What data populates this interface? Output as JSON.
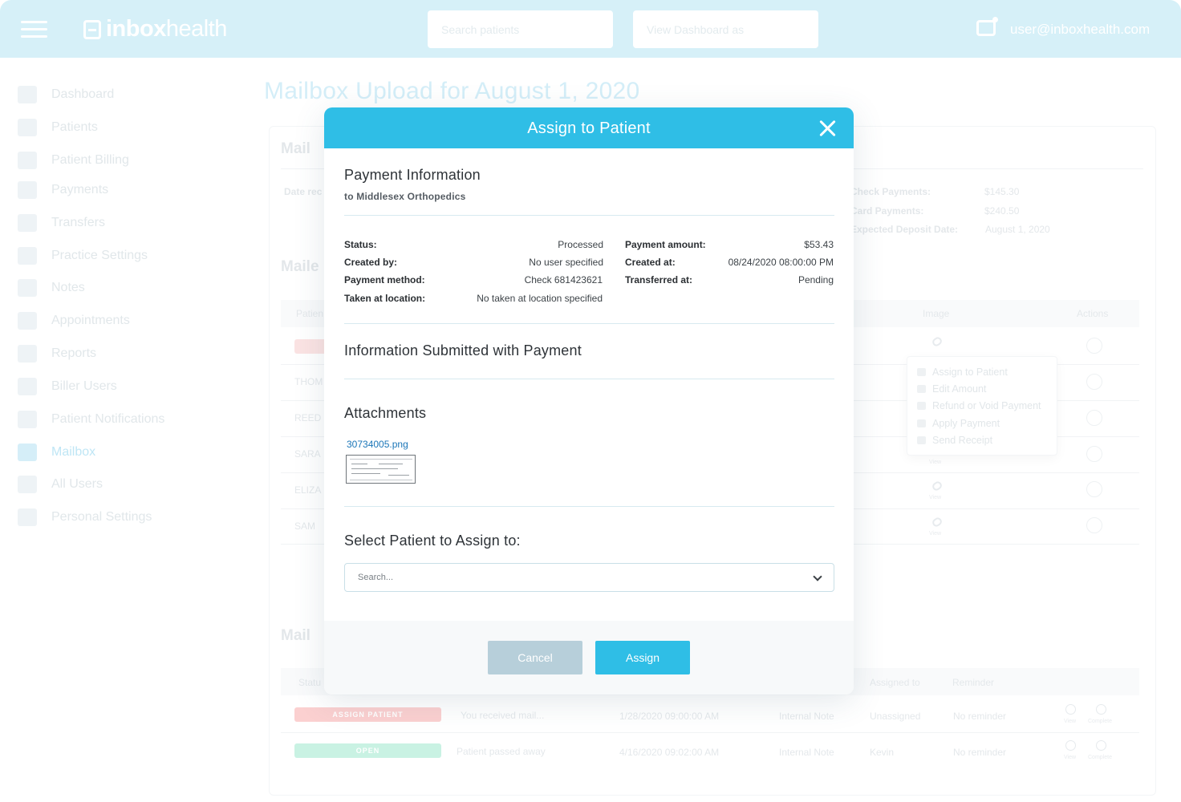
{
  "header": {
    "brand_bold": "inbox",
    "brand_light": "health",
    "search_placeholder": "Search patients",
    "view_dashboard_placeholder": "View Dashboard as",
    "user_email": "user@inboxhealth.com"
  },
  "sidebar": {
    "items": [
      {
        "label": "Dashboard",
        "icon": "dashboard-icon"
      },
      {
        "label": "Patients",
        "icon": "patients-icon"
      },
      {
        "label": "Patient Billing",
        "icon": "billing-icon"
      },
      {
        "label": "Payments",
        "icon": "card-icon"
      },
      {
        "label": "Transfers",
        "icon": "transfer-icon"
      },
      {
        "label": "Practice Settings",
        "icon": "building-icon"
      },
      {
        "label": "Notes",
        "icon": "note-icon"
      },
      {
        "label": "Appointments",
        "icon": "calendar-icon"
      },
      {
        "label": "Reports",
        "icon": "report-icon"
      },
      {
        "label": "Biller Users",
        "icon": "user-icon"
      },
      {
        "label": "Patient Notifications",
        "icon": "notification-icon"
      },
      {
        "label": "Mailbox",
        "icon": "mailbox-icon",
        "active": true
      },
      {
        "label": "All Users",
        "icon": "users-icon"
      },
      {
        "label": "Personal Settings",
        "icon": "gear-icon"
      }
    ]
  },
  "background": {
    "page_title": "Mailbox Upload for August 1, 2020",
    "section1_heading": "Mail",
    "date_label": "Date rec",
    "check_payments_label": "Check Payments:",
    "check_payments_value": "$145.30",
    "card_payments_label": "Card Payments:",
    "card_payments_value": "$240.50",
    "deposit_label": "Expected Deposit Date:",
    "deposit_value": "August 1, 2020",
    "section2_heading": "Maile",
    "table_col_patient": "Patien",
    "table_col_image": "Image",
    "table_col_actions": "Actions",
    "rows": [
      "THOM",
      "REED",
      "SARA",
      "ELIZA",
      "SAM"
    ],
    "view_label": "View",
    "menu": [
      "Assign to Patient",
      "Edit Amount",
      "Refund or Void Payment",
      "Apply Payment",
      "Send Receipt"
    ],
    "section3_heading": "Mail",
    "table2_col_status": "Statu",
    "table2_col_assigned": "Assigned to",
    "table2_col_reminder": "Reminder",
    "table2_rows": [
      {
        "badge": "ASSIGN PATIENT",
        "desc": "You received mail...",
        "date": "1/28/2020 09:00:00 AM",
        "type": "Internal Note",
        "assigned": "Unassigned",
        "reminder": "No reminder"
      },
      {
        "badge": "OPEN",
        "desc": "Patient passed away",
        "date": "4/16/2020 09:02:00 AM",
        "type": "Internal Note",
        "assigned": "Kevin",
        "reminder": "No reminder"
      }
    ],
    "complete_label": "Complete"
  },
  "modal": {
    "title": "Assign to Patient",
    "payment_info_title": "Payment Information",
    "payment_info_sub": "to Middlesex Orthopedics",
    "status_label": "Status:",
    "status_value": "Processed",
    "created_by_label": "Created by:",
    "created_by_value": "No user specified",
    "method_label": "Payment method:",
    "method_value": "Check 681423621",
    "location_label": "Taken at location:",
    "location_value": "No taken at location specified",
    "amount_label": "Payment amount:",
    "amount_value": "$53.43",
    "created_at_label": "Created at:",
    "created_at_value": "08/24/2020 08:00:00 PM",
    "transferred_label": "Transferred at:",
    "transferred_value": "Pending",
    "info_submitted_title": "Information Submitted with Payment",
    "attachments_title": "Attachments",
    "attachment_name": "30734005.png",
    "select_title": "Select Patient to Assign to:",
    "search_placeholder": "Search...",
    "cancel_label": "Cancel",
    "assign_label": "Assign"
  },
  "colors": {
    "accent": "#2fbee6",
    "header_bg": "#d6f0f8",
    "cancel_bg": "#b7cfda"
  }
}
